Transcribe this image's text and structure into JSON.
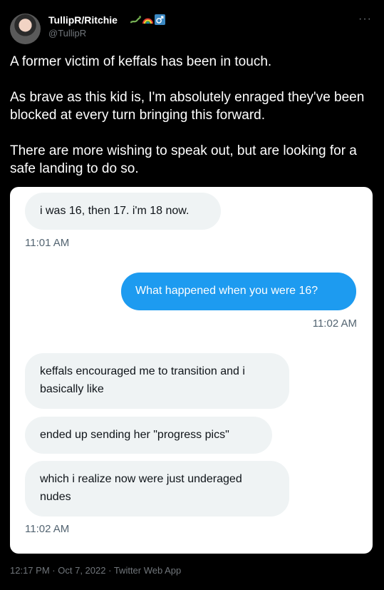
{
  "author": {
    "display_name": "TullipR/Ritchie",
    "handle": "@TullipR",
    "badges": [
      "lizard-emoji",
      "rainbow-emoji",
      "male-sign-emoji"
    ]
  },
  "tweet": {
    "paragraphs": [
      "A former victim of keffals has been in touch.",
      "As brave as this kid is, I'm absolutely enraged they've been blocked at every turn bringing this forward.",
      "There are more wishing to speak out, but are looking for a safe landing to do so."
    ]
  },
  "screenshot": {
    "messages": [
      {
        "side": "received",
        "text": "i was 16, then 17. i'm 18 now."
      },
      {
        "side": "received_time",
        "text": "11:01 AM"
      },
      {
        "side": "sent",
        "text": "What happened when you were 16?"
      },
      {
        "side": "sent_time",
        "text": "11:02 AM"
      },
      {
        "side": "received",
        "text": "keffals encouraged me to transition and i basically like"
      },
      {
        "side": "received",
        "text": "ended up sending her \"progress pics\""
      },
      {
        "side": "received",
        "text": "which i realize now were just underaged nudes"
      },
      {
        "side": "received_time",
        "text": "11:02 AM"
      }
    ]
  },
  "footer": {
    "time": "12:17 PM",
    "separator": "·",
    "date": "Oct 7, 2022",
    "source": "Twitter Web App"
  },
  "colors": {
    "background": "#000000",
    "sent_bubble": "#1d9bf0",
    "received_bubble": "#eff3f4",
    "meta_text": "#71767b"
  }
}
